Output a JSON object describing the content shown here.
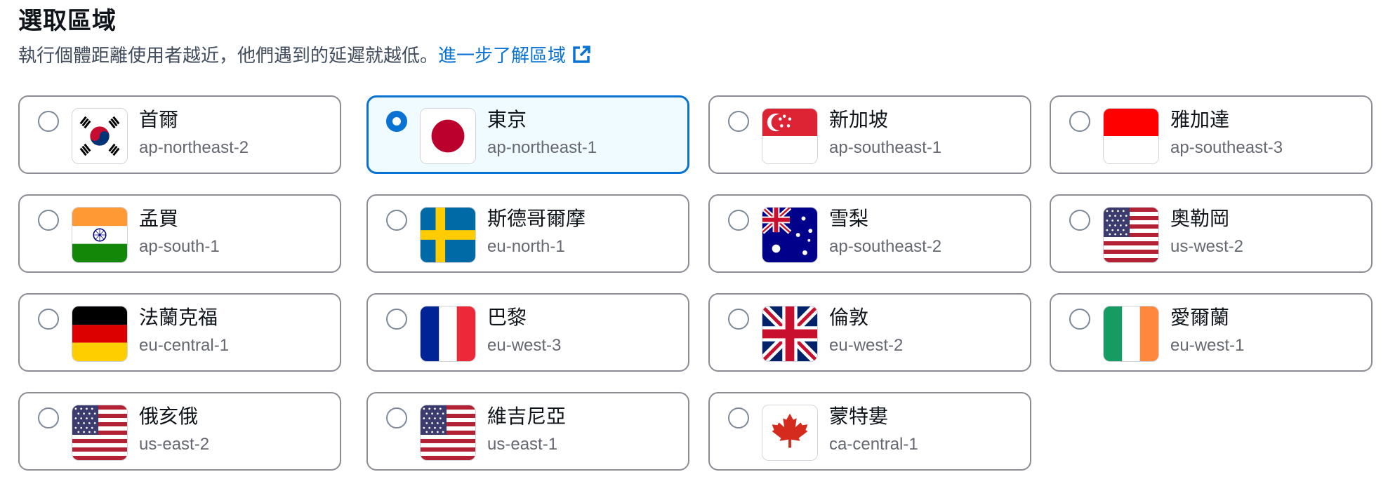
{
  "header": {
    "title": "選取區域",
    "description": "執行個體距離使用者越近，他們遇到的延遲就越低。",
    "learn_more": "進一步了解區域"
  },
  "selected_region": "ap-northeast-1",
  "regions": [
    {
      "name": "首爾",
      "code": "ap-northeast-2",
      "flag_icon": "south-korea-flag-icon"
    },
    {
      "name": "東京",
      "code": "ap-northeast-1",
      "flag_icon": "japan-flag-icon"
    },
    {
      "name": "新加坡",
      "code": "ap-southeast-1",
      "flag_icon": "singapore-flag-icon"
    },
    {
      "name": "雅加達",
      "code": "ap-southeast-3",
      "flag_icon": "indonesia-flag-icon"
    },
    {
      "name": "孟買",
      "code": "ap-south-1",
      "flag_icon": "india-flag-icon"
    },
    {
      "name": "斯德哥爾摩",
      "code": "eu-north-1",
      "flag_icon": "sweden-flag-icon"
    },
    {
      "name": "雪梨",
      "code": "ap-southeast-2",
      "flag_icon": "australia-flag-icon"
    },
    {
      "name": "奧勒岡",
      "code": "us-west-2",
      "flag_icon": "usa-flag-icon"
    },
    {
      "name": "法蘭克福",
      "code": "eu-central-1",
      "flag_icon": "germany-flag-icon"
    },
    {
      "name": "巴黎",
      "code": "eu-west-3",
      "flag_icon": "france-flag-icon"
    },
    {
      "name": "倫敦",
      "code": "eu-west-2",
      "flag_icon": "uk-flag-icon"
    },
    {
      "name": "愛爾蘭",
      "code": "eu-west-1",
      "flag_icon": "ireland-flag-icon"
    },
    {
      "name": "俄亥俄",
      "code": "us-east-2",
      "flag_icon": "usa-flag-icon"
    },
    {
      "name": "維吉尼亞",
      "code": "us-east-1",
      "flag_icon": "usa-flag-icon"
    },
    {
      "name": "蒙特婁",
      "code": "ca-central-1",
      "flag_icon": "canada-flag-icon"
    }
  ],
  "colors": {
    "accent": "#0972d3",
    "selected_bg": "#f0fbff",
    "border": "#8c8c94"
  }
}
